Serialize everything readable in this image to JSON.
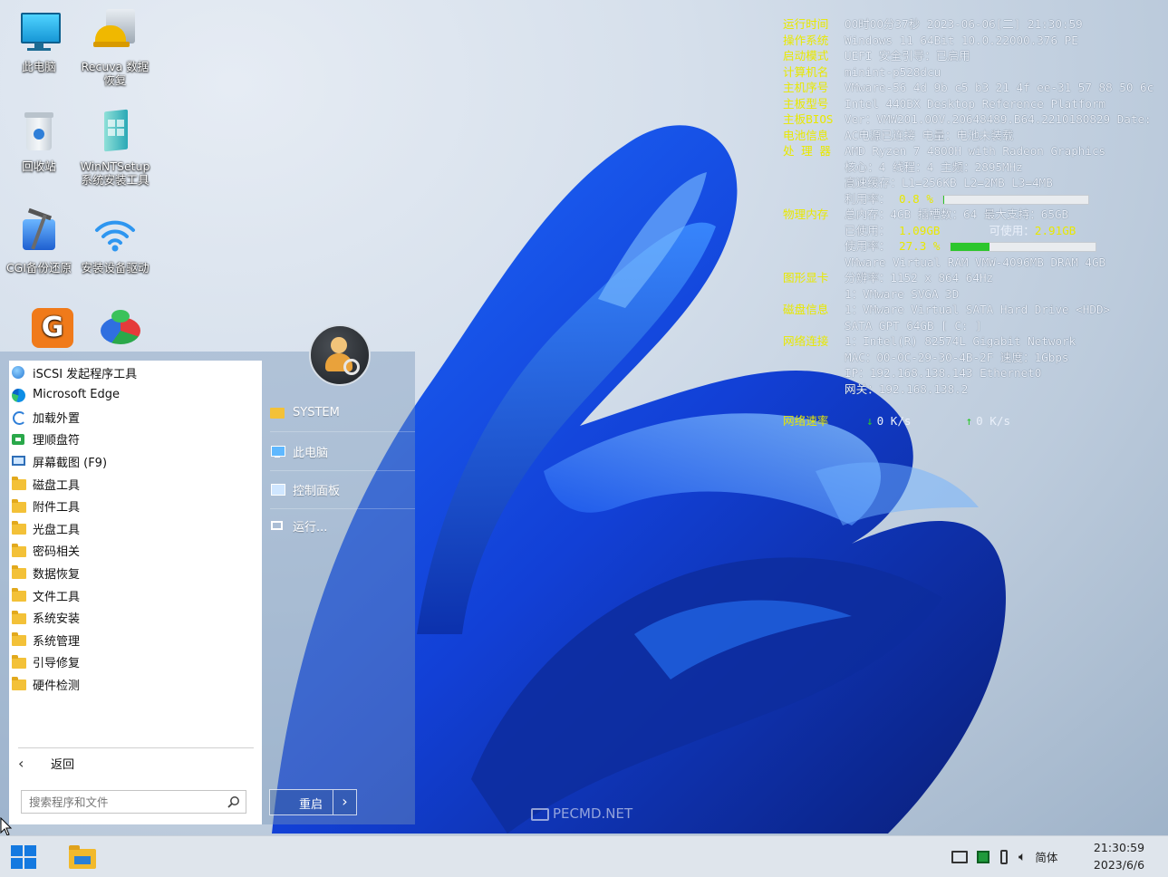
{
  "desktop": {
    "icons": [
      {
        "label": "此电脑",
        "icon": "computer-icon"
      },
      {
        "label": "Recuva 数据恢复",
        "icon": "recuva-icon"
      },
      {
        "label": "回收站",
        "icon": "recycle-bin-icon"
      },
      {
        "label": "WinNTSetup 系统安装工具",
        "icon": "setup-icon"
      },
      {
        "label": "CGI备份还原",
        "icon": "cgi-backup-icon"
      },
      {
        "label": "安装设备驱动",
        "icon": "wifi-icon"
      },
      {
        "label": "",
        "icon": "diskgenius-icon"
      },
      {
        "label": "",
        "icon": "partition-tool-icon"
      }
    ],
    "watermark": "PECMD.NET"
  },
  "sysinfo": {
    "rows": [
      {
        "key": "运行时间",
        "value": "00时00分37秒 2023-06-06[二] 21:30:59"
      },
      {
        "key": "操作系统",
        "value": "Windows 11 64Bit 10.0.22000.376 PE"
      },
      {
        "key": "启动模式",
        "value": "UEFI        安全引导：已启用"
      },
      {
        "key": "计算机名",
        "value": "minint-p528dcu"
      },
      {
        "key": "主机序号",
        "value": "VMware-56 4d 9b c5 b3 21 4f ee-31 57 88 50 6c"
      },
      {
        "key": "主板型号",
        "value": "Intel 440BX Desktop Reference Platform"
      },
      {
        "key": "主板BIOS",
        "value": "Ver：VMW201.00V.20648489.B64.2210180829  Date:"
      },
      {
        "key": "电池信息",
        "value": "AC电源已连接  电量：电池未装载"
      },
      {
        "key": "处 理 器",
        "value": "AMD Ryzen 7 4800H with Radeon Graphics"
      },
      {
        "key": "",
        "value": "核心：4  线程：4       主频：2895MHz"
      },
      {
        "key": "",
        "value": "高速缓存：L1=256KB L2=2MB L3=4MB"
      },
      {
        "key": "",
        "value": "利用率："
      },
      {
        "key": "物理内存",
        "value": "总内存：4GB 插槽数：64 最大支持：65GB"
      },
      {
        "key": "",
        "value": "已使用："
      },
      {
        "key": "",
        "value": "使用率："
      },
      {
        "key": "",
        "value": "VMware Virtual RAM VMW-4096MB DRAM 4GB"
      },
      {
        "key": "图形显卡",
        "value": "分辨率：1152 x 864 64Hz"
      },
      {
        "key": "",
        "value": "1：VMware SVGA 3D"
      },
      {
        "key": "磁盘信息",
        "value": "1：VMware Virtual SATA Hard Drive <HDD>"
      },
      {
        "key": "",
        "value": "   SATA GPT 64GB [ C: ]"
      },
      {
        "key": "网络连接",
        "value": "1：Intel(R) 82574L Gigabit Network"
      },
      {
        "key": "",
        "value": "   MAC：00-0C-29-30-4B-2F 速度：1Gbps"
      },
      {
        "key": "",
        "value": "   IP：192.168.138.143 Ethernet0"
      },
      {
        "key": "",
        "value": "   网关：192.168.138.2"
      },
      {
        "key": "",
        "value": ""
      },
      {
        "key": "网络速率",
        "value": ""
      }
    ],
    "cpu_usage": "0.8 %",
    "cpu_usage_fraction": 0.008,
    "mem_used": "1.09GB",
    "mem_free_label": "可使用：",
    "mem_free": "2.91GB",
    "mem_usage": "27.3 %",
    "mem_usage_fraction": 0.273,
    "net_down_arrow": "↓",
    "net_down": "0 K/s",
    "net_up_arrow": "↑",
    "net_up": "0 K/s"
  },
  "start_menu": {
    "items": [
      {
        "label": "iSCSI 发起程序工具",
        "icon": "iscsi-icon"
      },
      {
        "label": "Microsoft Edge",
        "icon": "edge-icon"
      },
      {
        "label": "加载外置",
        "icon": "refresh-icon"
      },
      {
        "label": "理顺盘符",
        "icon": "drive-letter-icon"
      },
      {
        "label": "屏幕截图 (F9)",
        "icon": "screenshot-icon"
      },
      {
        "label": "磁盘工具",
        "icon": "folder-icon"
      },
      {
        "label": "附件工具",
        "icon": "folder-icon"
      },
      {
        "label": "光盘工具",
        "icon": "folder-icon"
      },
      {
        "label": "密码相关",
        "icon": "folder-icon"
      },
      {
        "label": "数据恢复",
        "icon": "folder-icon"
      },
      {
        "label": "文件工具",
        "icon": "folder-icon"
      },
      {
        "label": "系统安装",
        "icon": "folder-icon"
      },
      {
        "label": "系统管理",
        "icon": "folder-icon"
      },
      {
        "label": "引导修复",
        "icon": "folder-icon"
      },
      {
        "label": "硬件检测",
        "icon": "folder-icon"
      }
    ],
    "back_label": "返回",
    "search_placeholder": "搜索程序和文件",
    "right_links": [
      {
        "label": "SYSTEM",
        "icon": "folder-icon"
      },
      {
        "label": "此电脑",
        "icon": "computer-icon"
      },
      {
        "label": "控制面板",
        "icon": "control-panel-icon"
      },
      {
        "label": "运行...",
        "icon": "run-icon"
      }
    ],
    "restart_label": "重启",
    "restart_arrow": "›"
  },
  "taskbar": {
    "ime_label": "简体",
    "time": "21:30:59",
    "date": "2023/6/6"
  }
}
